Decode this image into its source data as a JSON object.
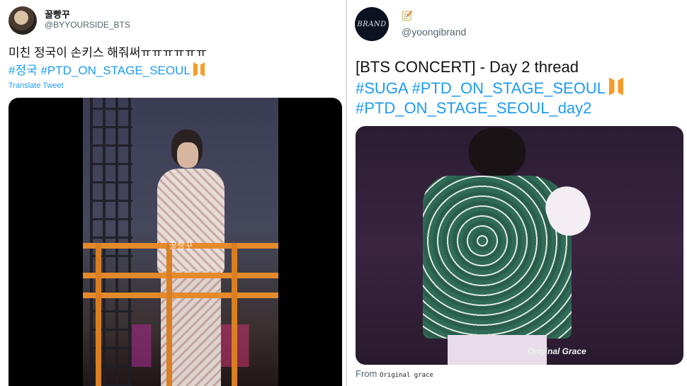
{
  "left_tweet": {
    "display_name": "꿀빵꾸",
    "handle": "@BYYOURSIDE_BTS",
    "text": "미친 정국이 손키스 해줘써ㅠㅠㅠㅠㅠㅠ",
    "hashtags": "#정국 #PTD_ON_STAGE_SEOUL",
    "translate_link": "Translate Tweet",
    "media_watermark": "꿀빵꾸"
  },
  "right_tweet": {
    "avatar_text": "BRAND",
    "handle": "@yoongibrand",
    "text": "[BTS CONCERT] - Day 2 thread",
    "hashtags_line1": "#SUGA #PTD_ON_STAGE_SEOUL",
    "hashtags_line2": "#PTD_ON_STAGE_SEOUL_day2",
    "media_watermark": "Original Grace",
    "from_label": "From",
    "from_source": "Original grace"
  },
  "colors": {
    "link_blue": "#1d9bf0",
    "bts_logo_orange": "#f39c2a",
    "secondary_text": "#536471"
  },
  "icons": [
    "bts-logo-icon",
    "memo-icon"
  ]
}
